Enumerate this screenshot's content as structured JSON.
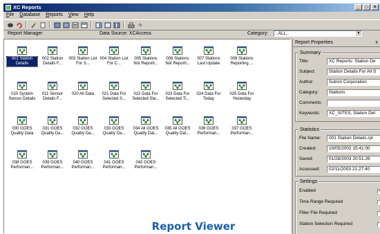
{
  "window": {
    "title": "XC Reports"
  },
  "menu": [
    "File",
    "Database",
    "Reports",
    "View",
    "Help"
  ],
  "infobar": {
    "report_manager": "Report Manager",
    "data_source": "Data Source: XCAccess",
    "category_label": "Category:",
    "category_value": "..ALL.."
  },
  "reports": [
    "001 Station Details",
    "002 Station Details F...",
    "003 Station List For S...",
    "004 Station List For C...",
    "005 Stations Not Reporti...",
    "006 Stations Not Reporti...",
    "007 Stations Last Update",
    "008 Stations Reporting ...",
    "010 System Sensor Details",
    "011 Sensor Details F...",
    "020 All Data",
    "021 Data For Selected S...",
    "022 Data For Selected Sta...",
    "023 Data For Selected Ti...",
    "024 Data For Today",
    "025 Data For Yesterday",
    "030 GOES Quality Data",
    "031 GOES Quality Da...",
    "032 GOES Quality Da...",
    "033 GOES Quality Da...",
    "034 All GOES Quality Dat...",
    "035 All GOES Quality Dat...",
    "036 GOES Performan...",
    "037 GOES Performan...",
    "038 GOES Performan...",
    "039 GOES Performan...",
    "040 GOES Performan...",
    "041 GOES Performan...",
    "042 GOES Performan..."
  ],
  "caption": "Report Viewer",
  "properties": {
    "header": "Report Properties",
    "close": "x",
    "summary_title": "Summary",
    "summary": [
      {
        "label": "Title:",
        "value": "XC Reports: Station De"
      },
      {
        "label": "Subject:",
        "value": "Station Details For All S"
      },
      {
        "label": "Author:",
        "value": "Sutron Corporation"
      },
      {
        "label": "Category:",
        "value": "Stations"
      },
      {
        "label": "Comments:",
        "value": ""
      },
      {
        "label": "Keywords:",
        "value": "XC_SITES, Station Det"
      }
    ],
    "statistics_title": "Statistics",
    "statistics": [
      {
        "label": "File Name:",
        "value": "001 Station Details.rpt"
      },
      {
        "label": "Created:",
        "value": "10/05/2002 15:41:00"
      },
      {
        "label": "Saved:",
        "value": "01/28/2003 20:51:26"
      },
      {
        "label": "Accessed:",
        "value": "02/11/2003 21:27:40"
      }
    ],
    "settings_title": "Settings",
    "settings": [
      {
        "label": "Enabled",
        "checked": true
      },
      {
        "label": "Time Range Required",
        "checked": false
      },
      {
        "label": "Filter File Required",
        "checked": false
      },
      {
        "label": "Station Selection Required",
        "checked": false
      }
    ]
  },
  "colors": {
    "titlebar": "#0a246a",
    "icon_green": "#3c9a3c",
    "selection": "#0a246a",
    "caption": "#1f5fa8"
  }
}
